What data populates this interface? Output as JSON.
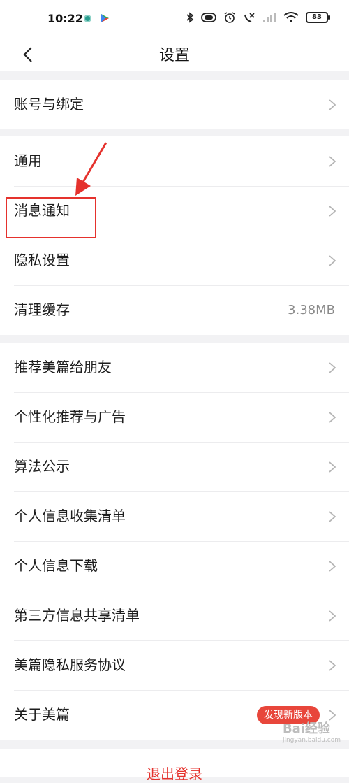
{
  "status_bar": {
    "time": "10:22",
    "battery": "83"
  },
  "header": {
    "title": "设置"
  },
  "sections": [
    {
      "items": [
        {
          "label": "账号与绑定"
        }
      ]
    },
    {
      "items": [
        {
          "label": "通用"
        },
        {
          "label": "消息通知"
        },
        {
          "label": "隐私设置"
        },
        {
          "label": "清理缓存",
          "value": "3.38MB"
        }
      ]
    },
    {
      "items": [
        {
          "label": "推荐美篇给朋友"
        },
        {
          "label": "个性化推荐与广告"
        },
        {
          "label": "算法公示"
        },
        {
          "label": "个人信息收集清单"
        },
        {
          "label": "个人信息下载"
        },
        {
          "label": "第三方信息共享清单"
        },
        {
          "label": "美篇隐私服务协议"
        },
        {
          "label": "关于美篇",
          "badge": "发现新版本"
        }
      ]
    }
  ],
  "logout_label": "退出登录",
  "watermark": {
    "text": "Bai经验",
    "sub": "jingyan.baidu.com"
  },
  "colors": {
    "accent": "#e5322d",
    "badge": "#e8463b",
    "separator": "#f2f2f4"
  },
  "icons": [
    "back-arrow-icon",
    "chevron-right-icon",
    "bluetooth-icon",
    "wifi-icon",
    "alarm-icon",
    "signal-icon"
  ]
}
